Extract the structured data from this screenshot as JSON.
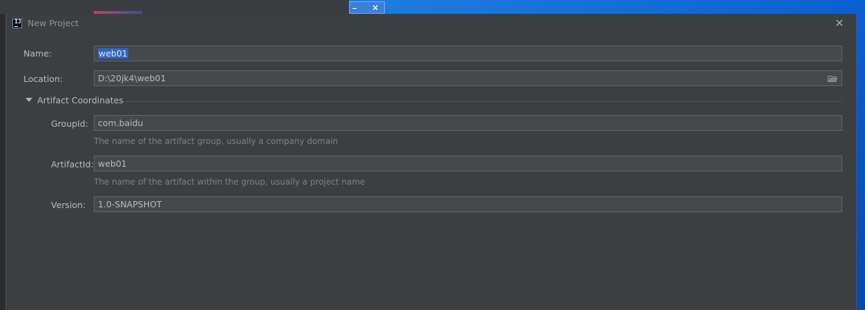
{
  "window": {
    "title": "New Project",
    "close_glyph": "✕"
  },
  "background": {
    "mini_window_min": "_",
    "mini_window_close": "×"
  },
  "form": {
    "name": {
      "label": "Name:",
      "value": "web01"
    },
    "location": {
      "label": "Location:",
      "value": "D:\\20jk4\\web01",
      "icon": "folder-icon"
    },
    "artifact_section": {
      "label": "Artifact Coordinates",
      "expanded": true
    },
    "group_id": {
      "label": "GroupId:",
      "value": "com.baidu",
      "hint": "The name of the artifact group, usually a company domain"
    },
    "artifact_id": {
      "label": "ArtifactId:",
      "value": "web01",
      "hint": "The name of the artifact within the group, usually a project name"
    },
    "version": {
      "label": "Version:",
      "value": "1.0-SNAPSHOT"
    }
  },
  "colors": {
    "dialog_bg": "#3c3f41",
    "field_bg": "#45494a",
    "selection": "#2f65ca",
    "desktop": "#0a5fd0"
  }
}
